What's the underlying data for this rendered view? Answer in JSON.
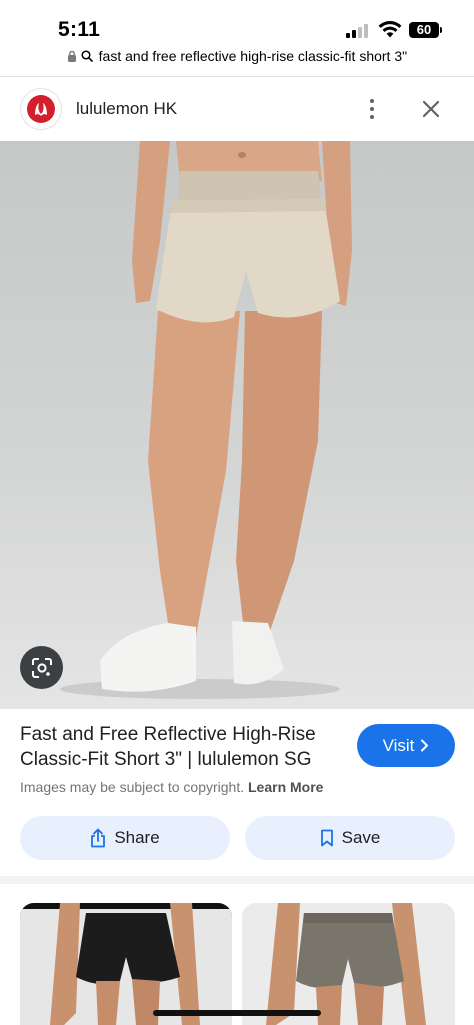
{
  "status_bar": {
    "time": "5:11",
    "battery": "60"
  },
  "url_bar": {
    "text": "fast and free reflective high-rise classic-fit short 3\""
  },
  "source": {
    "name": "lululemon HK"
  },
  "result": {
    "title": "Fast and Free Reflective High-Rise Classic-Fit Short 3\" | lululemon SG",
    "visit_label": "Visit",
    "copyright_text": "Images may be subject to copyright.",
    "learn_more_label": "Learn More"
  },
  "actions": {
    "share_label": "Share",
    "save_label": "Save"
  },
  "colors": {
    "accent": "#1a73e8",
    "action_bg": "#e8f0fe",
    "brand": "#d31f2c"
  },
  "icons": [
    "lock-icon",
    "search-icon",
    "lululemon-logo",
    "more-vert-icon",
    "close-icon",
    "google-lens-icon",
    "chevron-right-icon",
    "share-icon",
    "bookmark-icon"
  ]
}
